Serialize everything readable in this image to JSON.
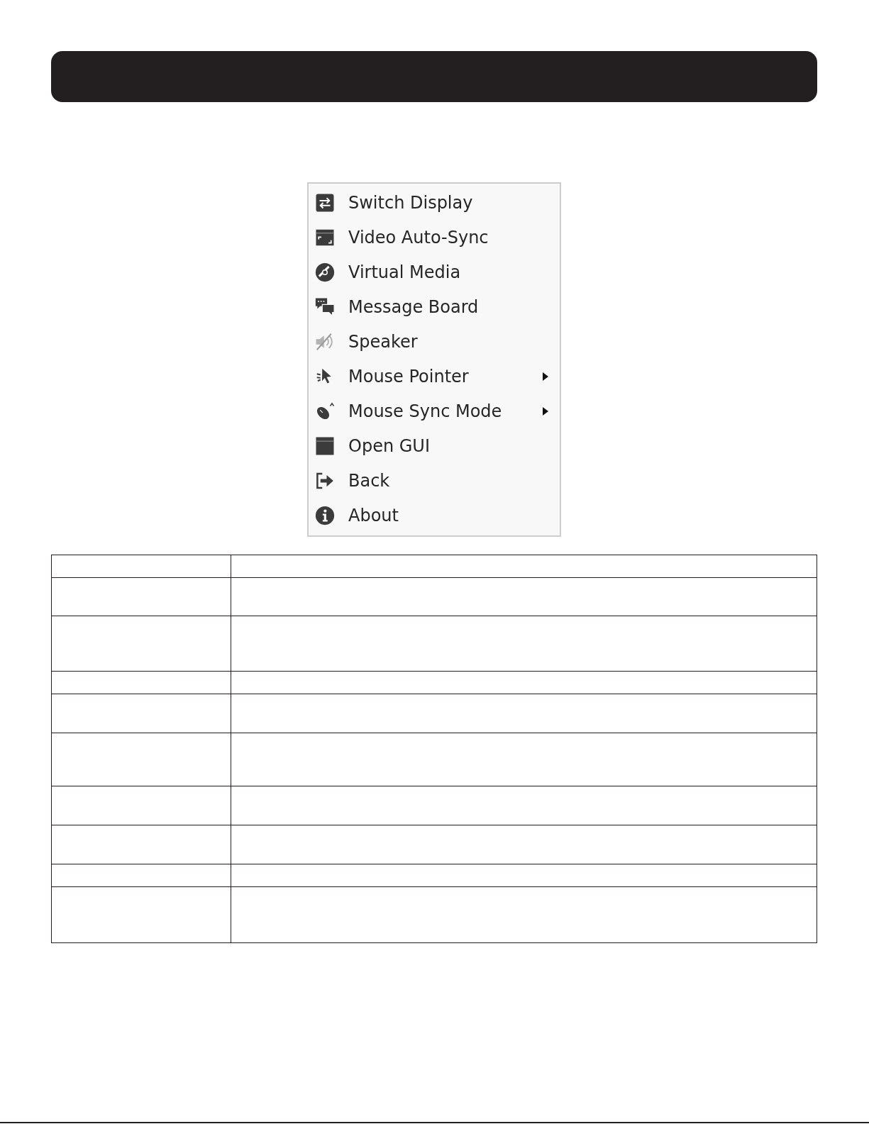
{
  "menu": {
    "items": [
      {
        "label": "Switch Display",
        "submenu": false
      },
      {
        "label": "Video Auto-Sync",
        "submenu": false
      },
      {
        "label": "Virtual Media",
        "submenu": false
      },
      {
        "label": "Message Board",
        "submenu": false
      },
      {
        "label": "Speaker",
        "submenu": false
      },
      {
        "label": "Mouse Pointer",
        "submenu": true
      },
      {
        "label": "Mouse Sync Mode",
        "submenu": true
      },
      {
        "label": "Open GUI",
        "submenu": false
      },
      {
        "label": "Back",
        "submenu": false
      },
      {
        "label": "About",
        "submenu": false
      }
    ]
  }
}
